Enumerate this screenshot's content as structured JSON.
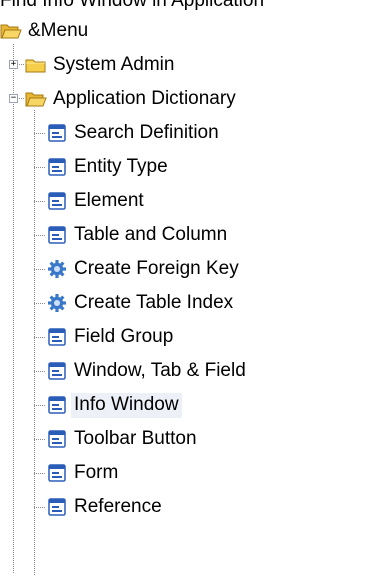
{
  "caption": "Find Info Window in Application",
  "tree": {
    "root": {
      "label": "&Menu",
      "icon": "folder-open-icon"
    },
    "system_admin": {
      "label": "System Admin",
      "icon": "folder-closed-icon",
      "expander": "+"
    },
    "app_dict": {
      "label": "Application Dictionary",
      "icon": "folder-open-icon",
      "expander": "−"
    },
    "items": [
      {
        "label": "Search Definition",
        "icon": "window-icon"
      },
      {
        "label": "Entity Type",
        "icon": "window-icon"
      },
      {
        "label": "Element",
        "icon": "window-icon"
      },
      {
        "label": "Table and Column",
        "icon": "window-icon"
      },
      {
        "label": "Create Foreign Key",
        "icon": "process-gear-icon"
      },
      {
        "label": "Create Table Index",
        "icon": "process-gear-icon"
      },
      {
        "label": "Field Group",
        "icon": "window-icon"
      },
      {
        "label": "Window, Tab & Field",
        "icon": "window-icon"
      },
      {
        "label": "Info Window",
        "icon": "window-icon",
        "selected": true
      },
      {
        "label": "Toolbar Button",
        "icon": "window-icon"
      },
      {
        "label": "Form",
        "icon": "window-icon"
      },
      {
        "label": "Reference",
        "icon": "window-icon"
      }
    ]
  },
  "colors": {
    "selection_bg": "#eef0f8",
    "folder_yellow": "#f5cf4a",
    "window_blue": "#2a5db8",
    "gear_blue": "#3a78c9"
  }
}
